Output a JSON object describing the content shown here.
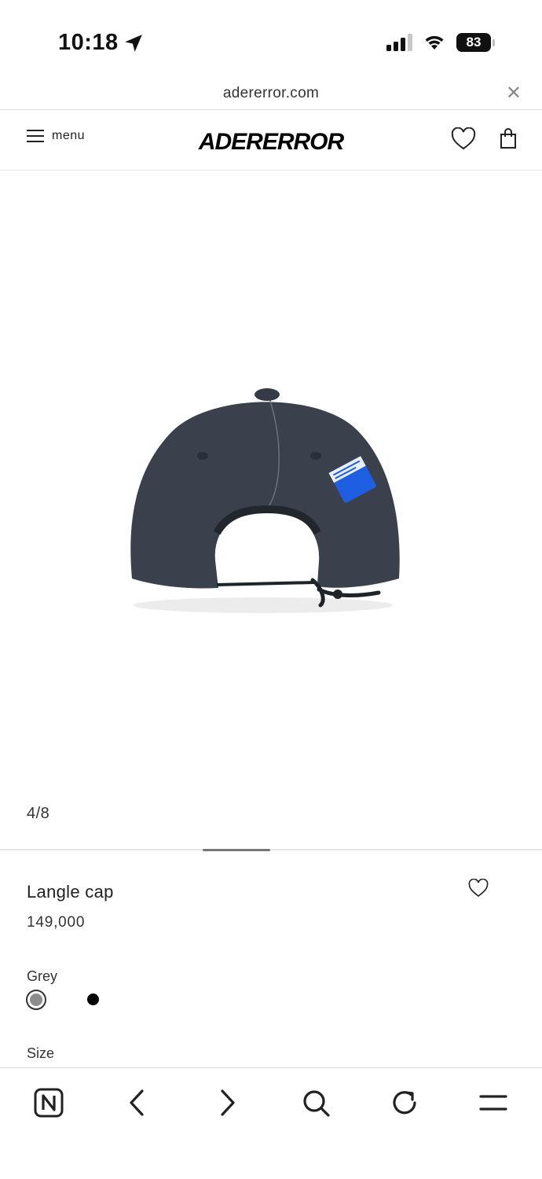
{
  "status_bar": {
    "time": "10:18",
    "battery": "83"
  },
  "browser": {
    "url": "adererror.com"
  },
  "header": {
    "menu_label": "menu",
    "logo": "ADERERROR"
  },
  "gallery": {
    "counter": "4/8",
    "image_alt": "Langle cap back view"
  },
  "product": {
    "name": "Langle cap",
    "price": "149,000",
    "selected_color": "Grey",
    "colors": [
      {
        "name": "Grey",
        "hex": "#8c8c8c",
        "selected": true
      },
      {
        "name": "Black",
        "hex": "#000000",
        "selected": false
      }
    ],
    "size_label": "Size"
  },
  "toolbar": {
    "icons": [
      "naver-home-icon",
      "back-icon",
      "forward-icon",
      "search-icon",
      "reload-icon",
      "menu-icon"
    ]
  },
  "colors": {
    "cap_body": "#3a414c",
    "patch": "#1d5fe0"
  }
}
